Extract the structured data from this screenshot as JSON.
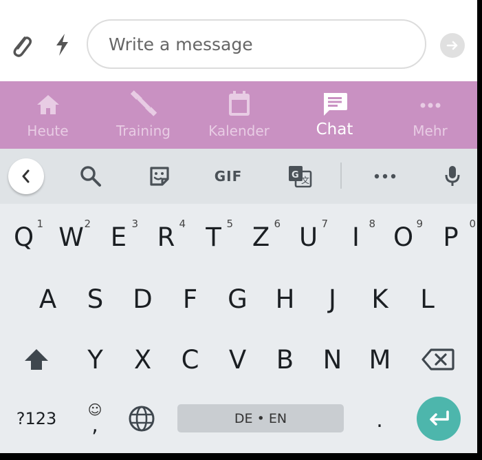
{
  "message_bar": {
    "input_placeholder": "Write a message",
    "icons": [
      "paperclip-icon",
      "bolt-icon",
      "send-arrow-icon"
    ]
  },
  "nav": {
    "bg_color": "#c991c2",
    "tabs": [
      {
        "label": "Heute",
        "icon": "home-icon",
        "active": false
      },
      {
        "label": "Training",
        "icon": "dumbbell-icon",
        "active": false
      },
      {
        "label": "Kalender",
        "icon": "calendar-icon",
        "active": false
      },
      {
        "label": "Chat",
        "icon": "chat-icon",
        "active": true
      },
      {
        "label": "Mehr",
        "icon": "more-dots-icon",
        "active": false
      }
    ]
  },
  "keyboard": {
    "toolbar": {
      "gif_label": "GIF",
      "icons": [
        "back-chevron-icon",
        "search-icon",
        "sticker-icon",
        "translate-icon",
        "more-icon",
        "mic-icon"
      ]
    },
    "row1": [
      {
        "key": "Q",
        "num": "1"
      },
      {
        "key": "W",
        "num": "2"
      },
      {
        "key": "E",
        "num": "3"
      },
      {
        "key": "R",
        "num": "4"
      },
      {
        "key": "T",
        "num": "5"
      },
      {
        "key": "Z",
        "num": "6"
      },
      {
        "key": "U",
        "num": "7"
      },
      {
        "key": "I",
        "num": "8"
      },
      {
        "key": "O",
        "num": "9"
      },
      {
        "key": "P",
        "num": "0"
      }
    ],
    "row2": [
      "A",
      "S",
      "D",
      "F",
      "G",
      "H",
      "J",
      "K",
      "L"
    ],
    "row3": [
      "Y",
      "X",
      "C",
      "V",
      "B",
      "N",
      "M"
    ],
    "bottom": {
      "symbols_label": "?123",
      "emoji_glyph": "☺",
      "comma": ",",
      "space_label": "DE • EN",
      "period": ".",
      "enter_color": "#4db6ac"
    }
  }
}
